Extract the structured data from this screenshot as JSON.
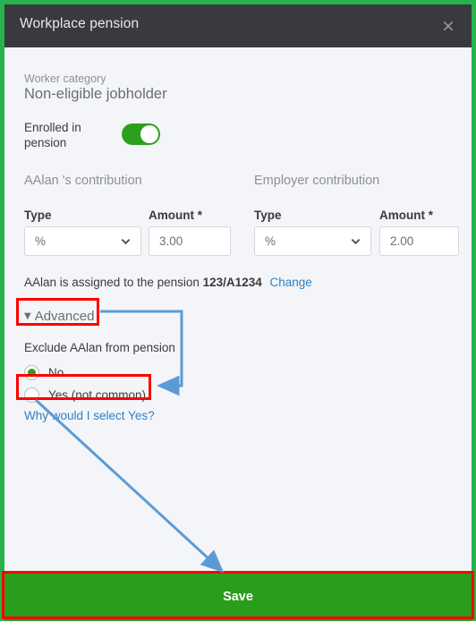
{
  "window": {
    "border_color": "#27b24b",
    "body_background": "#f4f5f8"
  },
  "titlebar": {
    "title": "Workplace pension",
    "background": "#393a3d",
    "close_icon": "close-icon",
    "close_glyph": "×"
  },
  "worker": {
    "category_label": "Worker category",
    "category_value": "Non-eligible jobholder",
    "enrolled_label": "Enrolled in pension",
    "enrolled_toggle_on": true,
    "toggle_color": "#2ca01c"
  },
  "contributions": {
    "employee": {
      "heading": "AAlan 's contribution",
      "type_label": "Type",
      "type_value": "%",
      "amount_label": "Amount *",
      "amount_value": "3.00"
    },
    "employer": {
      "heading": "Employer contribution",
      "type_label": "Type",
      "type_value": "%",
      "amount_label": "Amount *",
      "amount_value": "2.00"
    },
    "chevron_icon": "chevron-down-icon"
  },
  "assignment": {
    "text": "AAlan is assigned to the pension",
    "pension_id": "123/A1234",
    "change_link": "Change",
    "link_color": "#2e80c4"
  },
  "advanced": {
    "caret_icon": "caret-down-icon",
    "caret_glyph": "▼",
    "label": "Advanced",
    "exclude_label": "Exclude AAlan from pension",
    "options": [
      {
        "label": "No",
        "selected": true
      },
      {
        "label": "Yes (not common)",
        "selected": false
      }
    ],
    "help_link": "Why would I select Yes?"
  },
  "footer": {
    "save_label": "Save",
    "save_color": "#2a9d1c"
  },
  "annotations": {
    "highlight_color": "#fe0000",
    "arrow_color": "#5b9bd5",
    "highlights": [
      "Advanced",
      "Yes (not common)",
      "Save"
    ],
    "arrows": [
      {
        "from": "Advanced",
        "to": "Yes (not common)"
      },
      {
        "from": "Why would I select Yes?",
        "to": "Save"
      }
    ]
  }
}
